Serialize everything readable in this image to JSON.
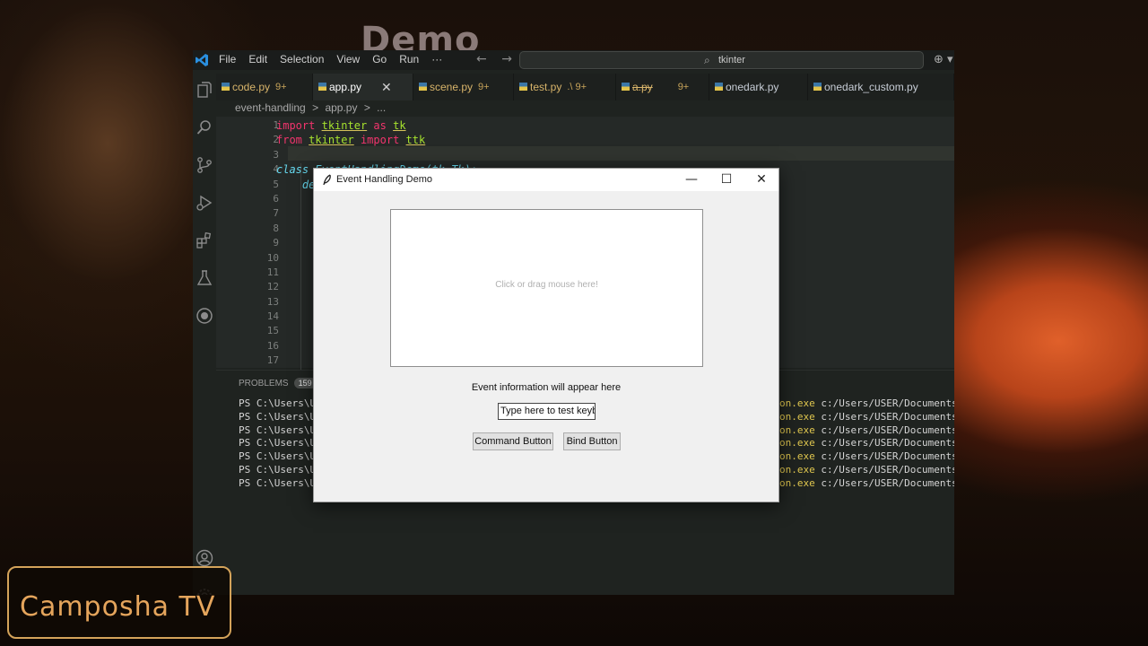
{
  "overlay": {
    "demo_title": "Demo",
    "channel_logo": "Camposha TV"
  },
  "vscode": {
    "menu": [
      "File",
      "Edit",
      "Selection",
      "View",
      "Go",
      "Run",
      "···"
    ],
    "search_text": "tkinter",
    "tabs": [
      {
        "label": "code.py",
        "badge": "9+"
      },
      {
        "label": "app.py",
        "badge": "",
        "active": true
      },
      {
        "label": "scene.py",
        "badge": "9+"
      },
      {
        "label": "test.py",
        "badge": ".\\ 9+"
      },
      {
        "label": "a.py",
        "badge": "9+"
      },
      {
        "label": "onedark.py",
        "badge": ""
      },
      {
        "label": "onedark_custom.py",
        "badge": ""
      }
    ],
    "breadcrumb": [
      "event-handling",
      ">",
      "app.py",
      ">",
      "..."
    ],
    "line_numbers": [
      "1",
      "2",
      "3",
      "4",
      "5",
      "6",
      "7",
      "8",
      "9",
      "10",
      "11",
      "12",
      "13",
      "14",
      "15",
      "16",
      "17"
    ],
    "code_lines": {
      "l1": [
        "import",
        "tkinter",
        "as",
        "tk"
      ],
      "l2": [
        "from",
        "tkinter",
        "import",
        "ttk"
      ],
      "l4": [
        "class",
        "EventHandlingDemo(tk.Tk):"
      ],
      "l5": [
        "def"
      ]
    },
    "panel": {
      "problems_label": "PROBLEMS",
      "problems_count": "159"
    },
    "terminal_prompt": "PS C:\\Users\\US",
    "terminal_exe": "on.exe",
    "terminal_path": "c:/Users/USER/Documents/py",
    "terminal_line_count": 7,
    "notification_count": "1"
  },
  "tk_dialog": {
    "title": "Event Handling Demo",
    "minimize": "—",
    "maximize": "☐",
    "close": "✕",
    "canvas_hint": "Click or drag mouse here!",
    "event_info": "Event information will appear here",
    "entry_value": "Type here to test keybc",
    "command_button": "Command Button",
    "bind_button": "Bind Button"
  }
}
